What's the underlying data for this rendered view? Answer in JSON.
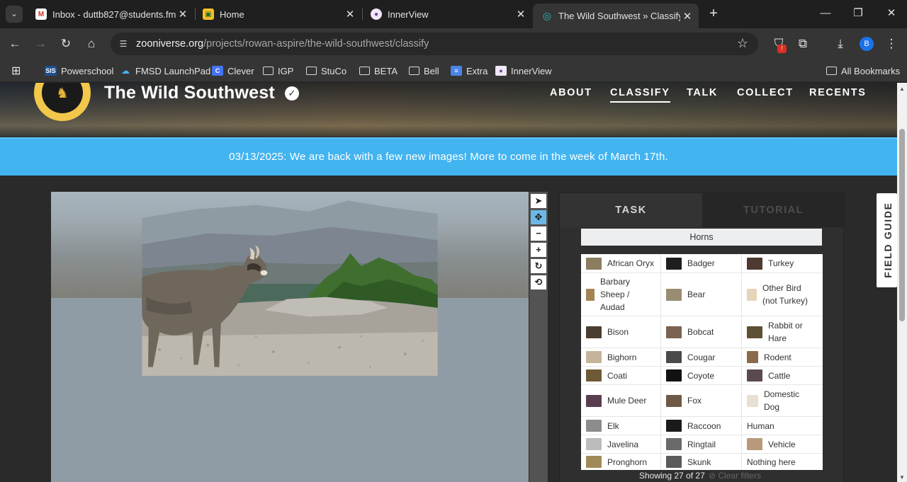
{
  "browser": {
    "tabs": [
      {
        "label": "Inbox - duttb827@students.fm",
        "favicon": "gmail-icon"
      },
      {
        "label": "Home",
        "favicon": "classroom-icon"
      },
      {
        "label": "InnerView",
        "favicon": "innerview-icon"
      },
      {
        "label": "The Wild Southwest » Classify",
        "favicon": "zooniverse-icon"
      }
    ],
    "url_host": "zooniverse.org",
    "url_path": "/projects/rowan-aspire/the-wild-southwest/classify",
    "profile_initial": "B",
    "extension_badge": "!",
    "bookmarks": [
      "Powerschool",
      "FMSD LaunchPad",
      "Clever",
      "IGP",
      "StuCo",
      "BETA",
      "Bell",
      "Extra",
      "InnerView"
    ],
    "all_bookmarks": "All Bookmarks"
  },
  "project": {
    "title": "The Wild Southwest",
    "nav": [
      "ABOUT",
      "CLASSIFY",
      "TALK",
      "COLLECT",
      "RECENTS"
    ]
  },
  "banner": "03/13/2025: We are back with a few new images! More to come in the week of March 17th.",
  "panel": {
    "tabs": [
      "TASK",
      "TUTORIAL"
    ],
    "filter_button": "Horns",
    "species": [
      "African Oryx",
      "Badger",
      "Turkey",
      "Barbary Sheep / Audad",
      "Bear",
      "Other Bird (not Turkey)",
      "Bison",
      "Bobcat",
      "Rabbit or Hare",
      "Bighorn",
      "Cougar",
      "Rodent",
      "Coati",
      "Coyote",
      "Cattle",
      "Mule Deer",
      "Fox",
      "Domestic Dog",
      "Elk",
      "Raccoon",
      "Human",
      "Javelina",
      "Ringtail",
      "Vehicle",
      "Pronghorn",
      "Skunk",
      "Nothing here"
    ],
    "showing": "Showing 27 of 27",
    "clear_filters": "Clear filters"
  },
  "field_guide": "FIELD GUIDE",
  "colors": {
    "banner": "#42b4f0",
    "accent_logo": "#f2c74a",
    "page_bg": "#2a2a2a"
  }
}
